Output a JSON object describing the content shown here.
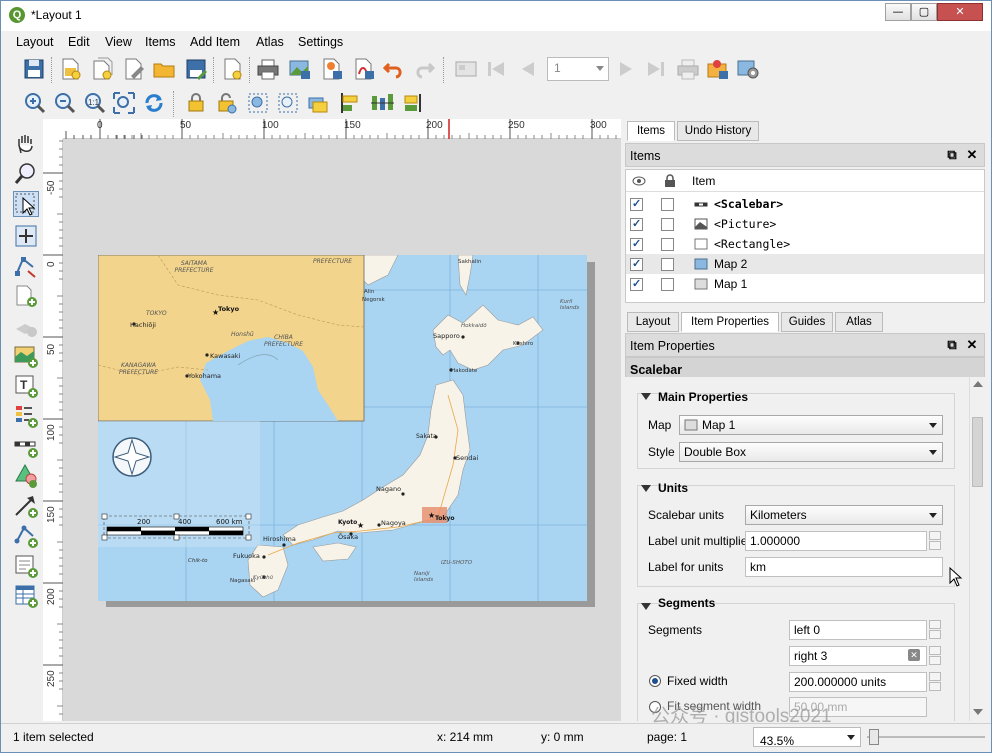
{
  "window": {
    "title": "*Layout 1"
  },
  "menu": [
    "Layout",
    "Edit",
    "View",
    "Items",
    "Add Item",
    "Atlas",
    "Settings"
  ],
  "toolbar": {
    "page_number": "1"
  },
  "ruler": {
    "h_labels": [
      "0",
      "50",
      "100",
      "150",
      "200",
      "250",
      "300"
    ],
    "v_labels": [
      "-50",
      "0",
      "50",
      "100",
      "150",
      "200",
      "250"
    ]
  },
  "map": {
    "inset_labels": [
      "SAITAMA PREFECTURE",
      "PREFECTURE",
      "TOKYO",
      "Tokyo",
      "Hachiōji",
      "Honshū",
      "CHIBA PREFECTURE",
      "Kawasaki",
      "KANAGAWA PREFECTURE",
      "Yokohama"
    ],
    "main_labels": [
      "Sakhalin",
      "Alin",
      "Negorsk",
      "Hokkaidō",
      "Sapporo",
      "Kushiro",
      "Hakodate",
      "Sakata",
      "Sendai",
      "Nagano",
      "Kyoto",
      "Nagoya",
      "Tokyo",
      "Hiroshima",
      "Ōsaka",
      "Fukuoka",
      "Chik-to",
      "Nagasaki",
      "Kyūshū",
      "Naniji Islands",
      "IZU-SHOTO",
      "Kuril Islands"
    ],
    "scalebar_labels": [
      "200",
      "400",
      "600 km"
    ]
  },
  "panels": {
    "top_tabs": [
      "Items",
      "Undo History"
    ],
    "items_title": "Items",
    "items_column": "Item",
    "items": [
      {
        "name": "<Scalebar>",
        "visible": true,
        "locked": false
      },
      {
        "name": "<Picture>",
        "visible": true,
        "locked": false
      },
      {
        "name": "<Rectangle>",
        "visible": true,
        "locked": false
      },
      {
        "name": "Map 2",
        "visible": true,
        "locked": false
      },
      {
        "name": "Map 1",
        "visible": true,
        "locked": false
      }
    ],
    "bottom_tabs": [
      "Layout",
      "Item Properties",
      "Guides",
      "Atlas"
    ],
    "props_title": "Item Properties",
    "props_subtitle": "Scalebar"
  },
  "properties": {
    "main": {
      "title": "Main Properties",
      "map_label": "Map",
      "map_value": "Map 1",
      "style_label": "Style",
      "style_value": "Double Box"
    },
    "units": {
      "title": "Units",
      "scalebar_units_label": "Scalebar units",
      "scalebar_units_value": "Kilometers",
      "label_multiplier_label": "Label unit multiplier",
      "label_multiplier_value": "1.000000",
      "label_units_label": "Label for units",
      "label_units_value": "km"
    },
    "segments": {
      "title": "Segments",
      "segments_label": "Segments",
      "left_value": "left 0",
      "right_value": "right 3",
      "fixed_width_label": "Fixed width",
      "fixed_width_value": "200.000000 units",
      "fit_width_label": "Fit segment width",
      "fit_width_value": "50.00 mm"
    }
  },
  "status": {
    "selection": "1 item selected",
    "x": "x: 214 mm",
    "y": "y: 0 mm",
    "page": "page: 1",
    "zoom": "43.5%"
  },
  "watermark": "公众号 · gistools2021"
}
